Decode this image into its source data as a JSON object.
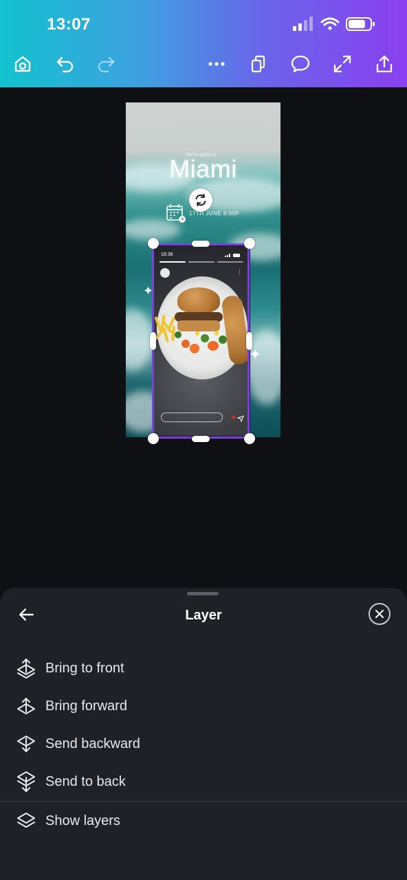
{
  "status_bar": {
    "time": "13:07"
  },
  "toolbar": {
    "icons": [
      "home-icon",
      "undo-icon",
      "redo-icon",
      "more-icon",
      "pages-icon",
      "comment-icon",
      "resize-icon",
      "share-icon"
    ],
    "gradient_colors": [
      "#12c2cf",
      "#8b3ff0"
    ]
  },
  "design": {
    "tagline": "We're going to...",
    "city": "Miami",
    "date_text": "17TH JUNE 8:00P",
    "phone_status_time": "18:38",
    "selection_color": "#7b3fe4"
  },
  "sheet": {
    "title": "Layer",
    "items": [
      {
        "label": "Bring to front",
        "icon": "bring-to-front-icon"
      },
      {
        "label": "Bring forward",
        "icon": "bring-forward-icon"
      },
      {
        "label": "Send backward",
        "icon": "send-backward-icon"
      },
      {
        "label": "Send to back",
        "icon": "send-to-back-icon"
      },
      {
        "label": "Show layers",
        "icon": "layers-icon"
      }
    ]
  }
}
